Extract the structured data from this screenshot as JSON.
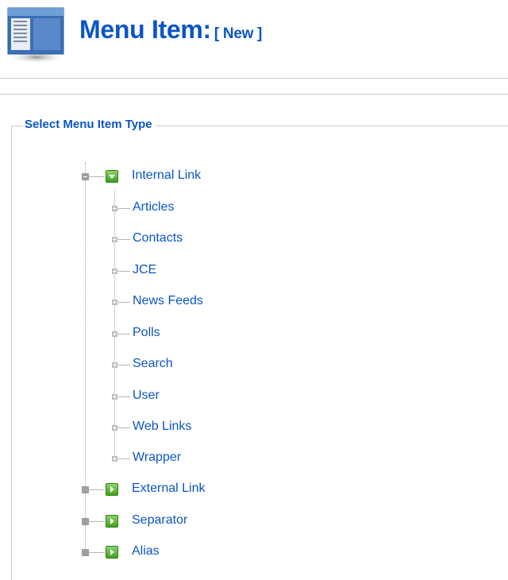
{
  "header": {
    "title": "Menu Item:",
    "subtitle": "[ New ]",
    "icon": "menu-item-icon"
  },
  "section": {
    "legend": "Select Menu Item Type"
  },
  "tree": {
    "internal_link": {
      "label": "Internal Link",
      "icon": "green-expanded-arrow-icon",
      "children": [
        "Articles",
        "Contacts",
        "JCE",
        "News Feeds",
        "Polls",
        "Search",
        "User",
        "Web Links",
        "Wrapper"
      ]
    },
    "external_link": {
      "label": "External Link",
      "icon": "green-right-arrow-icon"
    },
    "separator": {
      "label": "Separator",
      "icon": "green-right-arrow-icon"
    },
    "alias": {
      "label": "Alias",
      "icon": "green-right-arrow-icon"
    }
  },
  "colors": {
    "accent": "#0b55c4",
    "rule": "#cccccc",
    "icon_green": "#3f9f1f"
  }
}
